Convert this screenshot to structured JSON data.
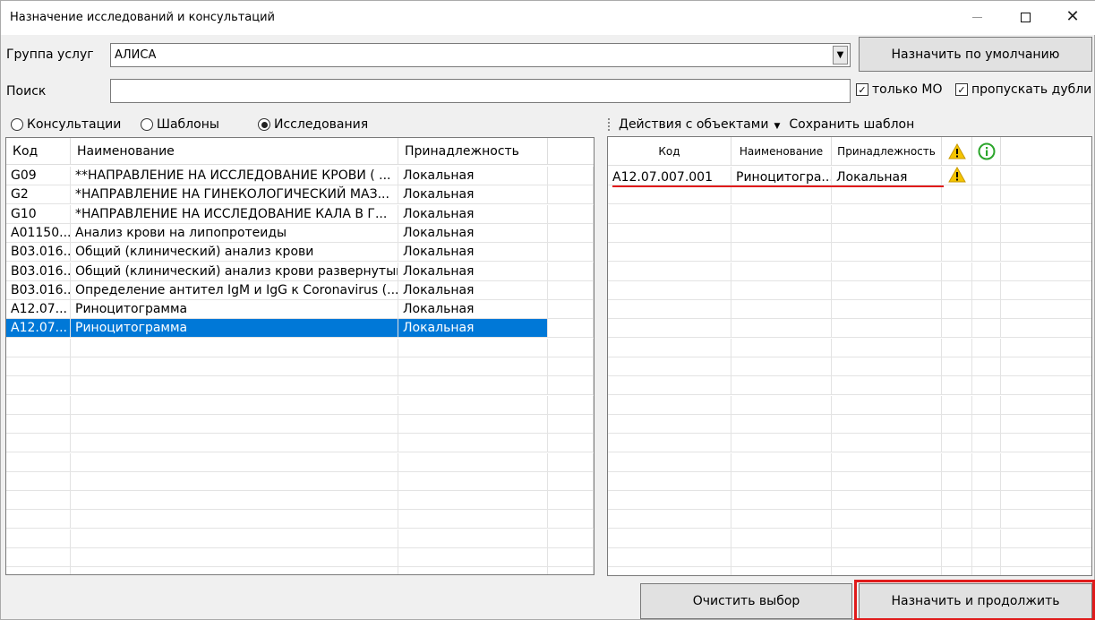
{
  "window": {
    "title": "Назначение исследований и консультаций"
  },
  "form": {
    "group_label": "Группа услуг",
    "group_value": "АЛИСА",
    "search_label": "Поиск",
    "search_value": "",
    "default_button": "Назначить по умолчанию",
    "only_mo_label": "только МО",
    "only_mo_checked": true,
    "skip_dupes_label": "пропускать дубли",
    "skip_dupes_checked": true
  },
  "radios": [
    {
      "label": "Консультации",
      "selected": false
    },
    {
      "label": "Шаблоны",
      "selected": false
    },
    {
      "label": "Исследования",
      "selected": true
    }
  ],
  "left_table": {
    "headers": [
      "Код",
      "Наименование",
      "Принадлежность"
    ],
    "rows": [
      {
        "code": "G09",
        "name": "**НАПРАВЛЕНИЕ НА ИССЛЕДОВАНИЕ КРОВИ ( ...",
        "owner": "Локальная"
      },
      {
        "code": "G2",
        "name": "*НАПРАВЛЕНИЕ НА ГИНЕКОЛОГИЧЕСКИЙ МАЗ...",
        "owner": "Локальная"
      },
      {
        "code": "G10",
        "name": "*НАПРАВЛЕНИЕ НА ИССЛЕДОВАНИЕ КАЛА  В Г...",
        "owner": "Локальная"
      },
      {
        "code": "A01150...",
        "name": "Анализ крови на липопротеиды",
        "owner": "Локальная"
      },
      {
        "code": "B03.016...",
        "name": "Общий (клинический) анализ крови",
        "owner": "Локальная"
      },
      {
        "code": "B03.016...",
        "name": "Общий (клинический) анализ крови развернутый",
        "owner": "Локальная"
      },
      {
        "code": "B03.016...",
        "name": "Определение антител IgM и IgG к Coronavirus (...",
        "owner": "Локальная"
      },
      {
        "code": "A12.07...",
        "name": "Риноцитограмма",
        "owner": "Локальная"
      },
      {
        "code": "A12.07...",
        "name": "Риноцитограмма",
        "owner": "Локальная",
        "selected": true
      }
    ]
  },
  "toolbar": {
    "actions_label": "Действия с объектами",
    "save_template_label": "Сохранить шаблон"
  },
  "right_table": {
    "headers": [
      "Код",
      "Наименование",
      "Принадлежность"
    ],
    "rows": [
      {
        "code": "A12.07.007.001",
        "name": "Риноцитогра...",
        "owner": "Локальная",
        "warning": true
      }
    ]
  },
  "buttons": {
    "clear": "Очистить выбор",
    "assign": "Назначить и продолжить"
  },
  "colors": {
    "selection": "#0078d7",
    "highlight": "#e01b1b",
    "warning": "#f5c400",
    "info": "#2aa52a"
  }
}
